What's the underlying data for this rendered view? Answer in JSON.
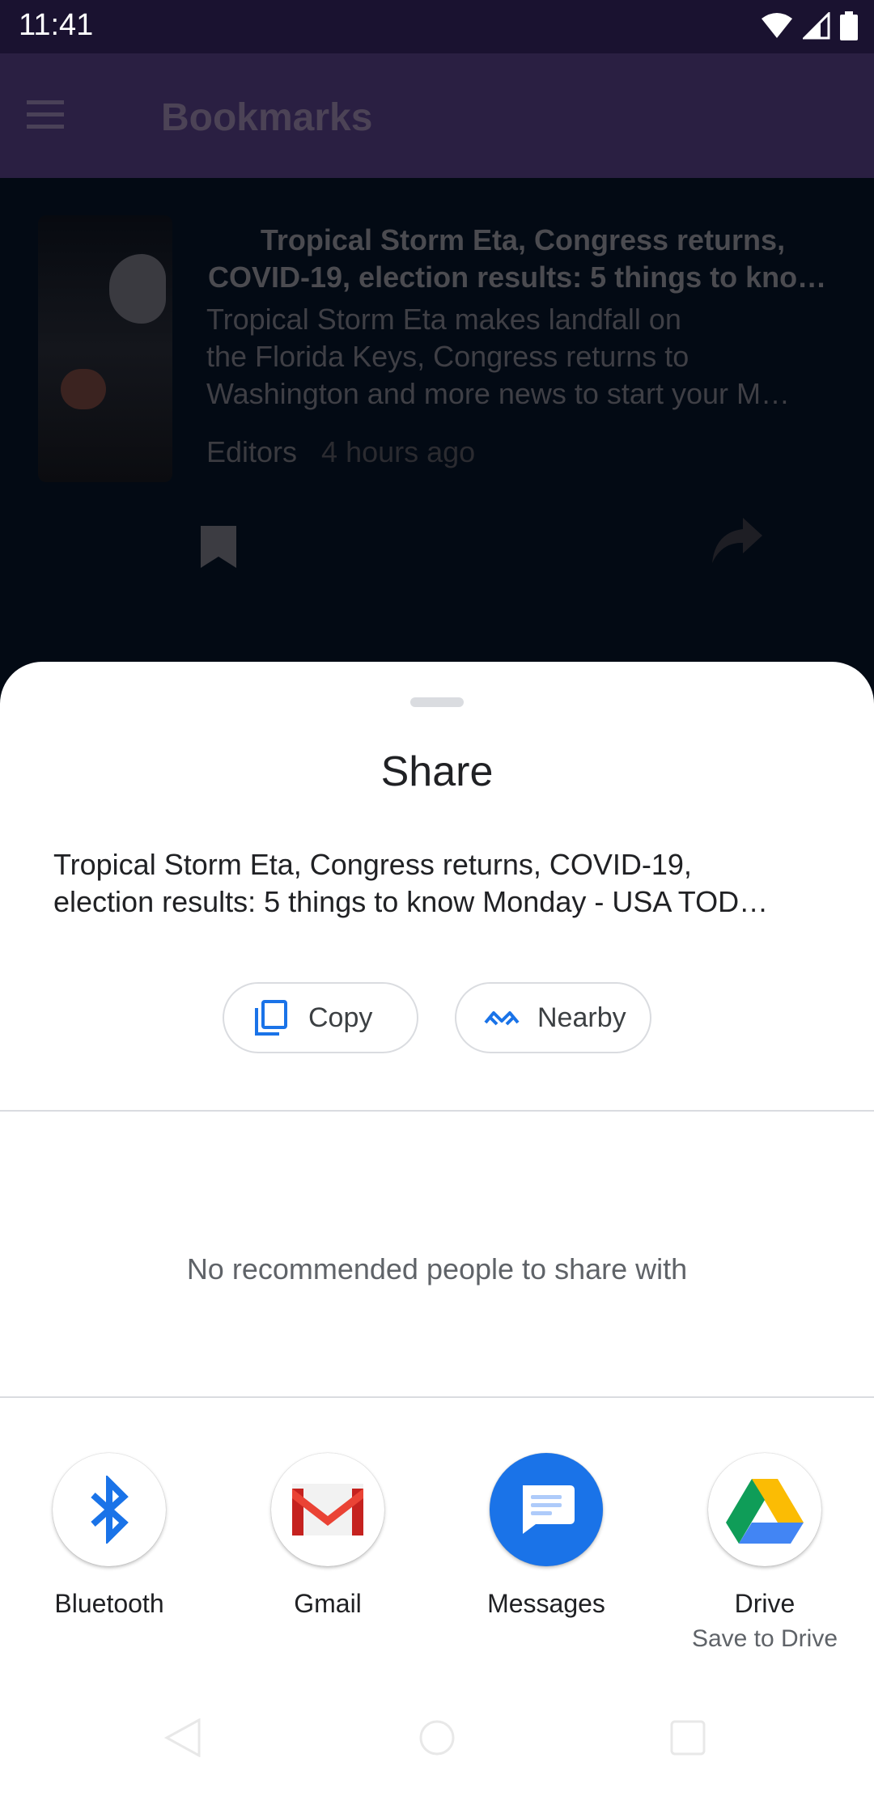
{
  "status_bar": {
    "time": "11:41",
    "icons": [
      "wifi-icon",
      "signal-icon",
      "battery-icon"
    ]
  },
  "app_bar": {
    "title": "Bookmarks",
    "menu_icon": "hamburger-icon"
  },
  "article": {
    "title_line1": "Tropical Storm Eta, Congress returns,",
    "title_line2": "COVID-19, election results: 5 things to kno…",
    "desc_line1": "Tropical Storm Eta makes landfall on",
    "desc_line2": "the Florida Keys, Congress returns to",
    "desc_line3": "Washington and more news to start your M…",
    "author": "Editors",
    "time_ago": "4 hours ago",
    "actions": [
      "bookmark-icon",
      "share-icon"
    ]
  },
  "share_sheet": {
    "title": "Share",
    "text_line1": "Tropical Storm Eta, Congress returns, COVID-19,",
    "text_line2": "election results: 5 things to know Monday - USA TOD…",
    "copy_label": "Copy",
    "nearby_label": "Nearby",
    "no_people": "No recommended people to share with",
    "targets": [
      {
        "label": "Bluetooth",
        "sub": "",
        "icon": "bluetooth-icon"
      },
      {
        "label": "Gmail",
        "sub": "",
        "icon": "gmail-icon"
      },
      {
        "label": "Messages",
        "sub": "",
        "icon": "messages-icon"
      },
      {
        "label": "Drive",
        "sub": "Save to Drive",
        "icon": "drive-icon"
      }
    ]
  },
  "colors": {
    "accent_blue": "#1a73e8",
    "statusbar": "#1a1230",
    "appbar": "#2a1f42"
  }
}
